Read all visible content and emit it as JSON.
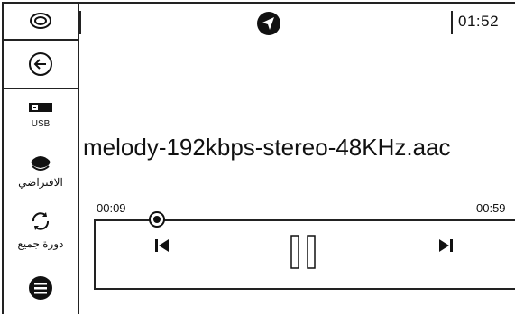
{
  "header": {
    "clock": "01:52"
  },
  "sidebar": {
    "usb_label": "USB",
    "preset_label": "الافتراضي",
    "repeat_label": "دورة جميع"
  },
  "track": {
    "title": "melody-192kbps-stereo-48KHz.aac",
    "elapsed": "00:09",
    "duration": "00:59",
    "progress": 0.15
  },
  "icons": {
    "home": "home-logo-icon",
    "back": "back-arrow-icon",
    "usb": "usb-drive-icon",
    "preset": "sound-preset-icon",
    "repeat": "repeat-icon",
    "list": "playlist-menu-icon",
    "navigation": "navigation-icon",
    "previous": "previous-track-icon",
    "pause": "pause-icon",
    "next": "next-track-icon"
  }
}
